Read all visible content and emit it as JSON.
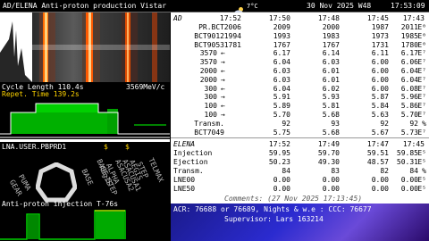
{
  "topbar": {
    "title": "AD/ELENA  Anti-proton production Vistar",
    "weather_icon": "cloud-sun-icon",
    "temperature": "7°C",
    "date": "30 Nov 2025 W48",
    "time": "17:53:09"
  },
  "left": {
    "cycle_length": "Cycle Length 110.4s",
    "momentum": "3569MeV/c",
    "repet_time": "Repet. Time  139.2s",
    "lna_title": "LNA.USER.PBPRD1",
    "dollar1": "$",
    "dollar2": "$",
    "radial_labels": [
      "GEAR",
      "PUMA",
      "BASE",
      "BASE-STEP",
      "AEgIS",
      "ALPHA",
      "ASACUSA2",
      "ASACUSA1",
      "AEGIS",
      "STEP",
      "TELMAX"
    ],
    "injection_title": "Anti-proton injection T-76s",
    "colors": {
      "green": "#00cc00",
      "yellow": "#ffd400",
      "heat_orange": "#ff6a00"
    }
  },
  "right": {
    "ad_header": [
      "AD",
      "17:52",
      "17:50",
      "17:48",
      "17:45",
      "17:43"
    ],
    "ad_rows": [
      {
        "label": "PR.BCT",
        "arrow": "",
        "v": [
          "2006",
          "2009",
          "2000",
          "1987",
          "2011"
        ],
        "unit": "E⁰"
      },
      {
        "label": "BCT9012",
        "arrow": "",
        "v": [
          "1994",
          "1993",
          "1983",
          "1973",
          "1985"
        ],
        "unit": "E⁰"
      },
      {
        "label": "BCT9053",
        "arrow": "",
        "v": [
          "1781",
          "1767",
          "1767",
          "1731",
          "1780"
        ],
        "unit": "E⁰"
      },
      {
        "label": "3570",
        "arrow": "←",
        "v": [
          "",
          "6.17",
          "6.14",
          "6.11",
          "6.17"
        ],
        "unit": "E⁷"
      },
      {
        "label": "3570",
        "arrow": "→",
        "v": [
          "",
          "6.04",
          "6.03",
          "6.00",
          "6.06"
        ],
        "unit": "E⁷"
      },
      {
        "label": "2000",
        "arrow": "←",
        "v": [
          "",
          "6.03",
          "6.01",
          "6.00",
          "6.04"
        ],
        "unit": "E⁷"
      },
      {
        "label": "2000",
        "arrow": "→",
        "v": [
          "",
          "6.03",
          "6.01",
          "6.00",
          "6.04"
        ],
        "unit": "E⁷"
      },
      {
        "label": "300",
        "arrow": "←",
        "v": [
          "",
          "6.04",
          "6.02",
          "6.00",
          "6.08"
        ],
        "unit": "E⁷"
      },
      {
        "label": "300",
        "arrow": "→",
        "v": [
          "",
          "5.91",
          "5.93",
          "5.87",
          "5.96"
        ],
        "unit": "E⁷"
      },
      {
        "label": "100",
        "arrow": "←",
        "v": [
          "",
          "5.89",
          "5.81",
          "5.84",
          "5.86"
        ],
        "unit": "E⁷"
      },
      {
        "label": "100",
        "arrow": "→",
        "v": [
          "",
          "5.70",
          "5.68",
          "5.63",
          "5.70"
        ],
        "unit": "E⁷"
      },
      {
        "label": "Transm.",
        "arrow": "",
        "v": [
          "",
          "92",
          "93",
          "92",
          "92"
        ],
        "unit": "%"
      },
      {
        "label": "BCT7049",
        "arrow": "",
        "v": [
          "",
          "5.75",
          "5.68",
          "5.67",
          "5.73"
        ],
        "unit": "E⁷"
      }
    ],
    "elena_header": [
      "ELENA",
      "17:52",
      "17:49",
      "17:47",
      "17:45"
    ],
    "elena_rows": [
      {
        "label": "Injection",
        "v": [
          "59.95",
          "59.70",
          "59.51",
          "59.85"
        ],
        "unit": "E⁵"
      },
      {
        "label": "Ejection",
        "v": [
          "50.23",
          "49.30",
          "48.57",
          "50.31"
        ],
        "unit": "E⁵"
      },
      {
        "label": "Transm.",
        "v": [
          "84",
          "83",
          "82",
          "84"
        ],
        "unit": "%"
      },
      {
        "label": "LNE00",
        "v": [
          "0.00",
          "0.00",
          "0.00",
          "0.00"
        ],
        "unit": "E⁵"
      },
      {
        "label": "LNE50",
        "v": [
          "0.00",
          "0.00",
          "0.00",
          "0.00"
        ],
        "unit": "E⁵"
      }
    ],
    "comments": "Comments:  (27 Nov 2025  17:13:45)"
  },
  "footer": {
    "line1": "ACR: 76688 or 76689, Nights & w.e : CCC: 76677",
    "line2": "Supervisor: Lars 163214"
  }
}
